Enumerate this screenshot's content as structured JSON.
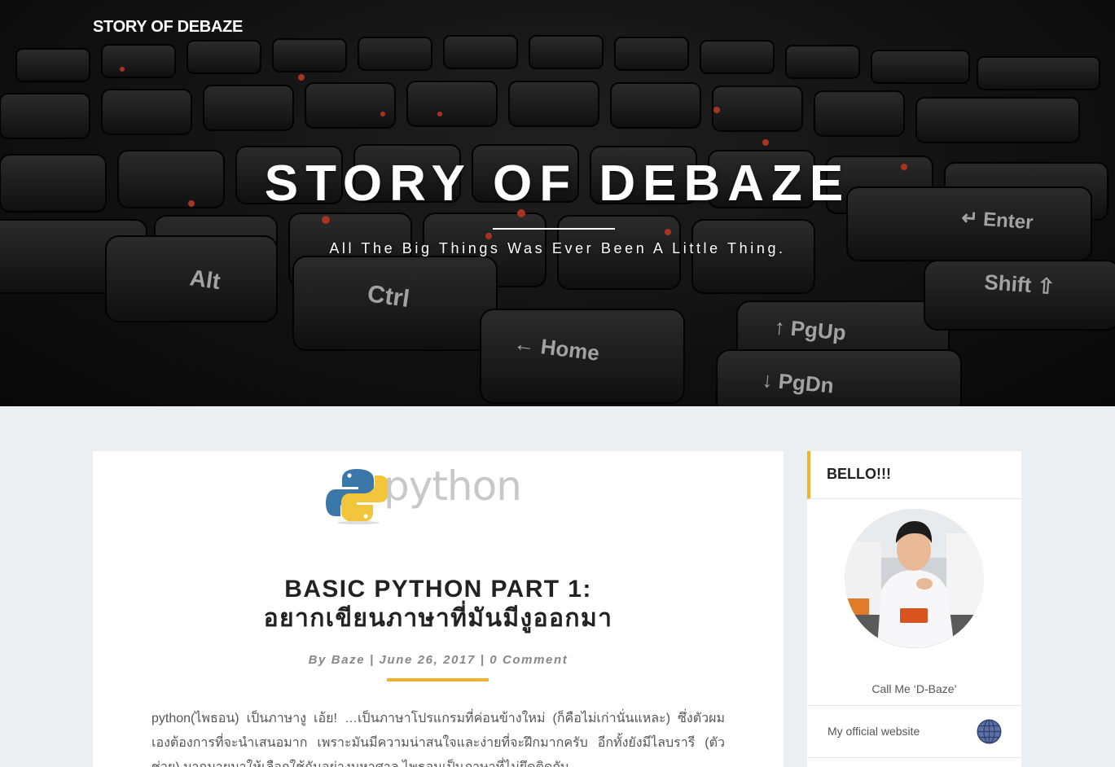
{
  "header": {
    "brand": "STORY OF DEBAZE",
    "site_title": "STORY OF DEBAZE",
    "tagline": "All The Big Things Was Ever Been A Little Thing."
  },
  "post": {
    "logo_text": "python",
    "title_line1": "BASIC PYTHON PART 1:",
    "title_line2": "อยากเขียนภาษาที่มันมีงูออกมา",
    "meta": {
      "by": "By",
      "author": "Baze",
      "sep": "|",
      "date": "June 26, 2017",
      "comments": "0 Comment"
    },
    "excerpt": "python(ไพธอน) เป็นภาษางู เอ้ย! …เป็นภาษาโปรแกรมที่ค่อนข้างใหม่ (ก็คือไม่เก่านั่นแหละ) ซึ่งตัวผมเองต้องการที่จะนำเสนอมาก เพราะมันมีความน่าสนใจและง่ายที่จะฝึกมากครับ อีกทั้งยังมีไลบรารี (ตัวช่วย) มากมายมาให้เลือกใช้กันอย่างมหาศาล ไพธอนเป็นภาษาที่ไม่ยึดติดกับ"
  },
  "sidebar": {
    "widget_title": "BELLO!!!",
    "caption": "Call Me ‘D-Baze’",
    "link_label": "My official website",
    "link_icon": "globe-icon"
  },
  "colors": {
    "accent": "#f4b12e",
    "page_bg": "#ebeff2"
  }
}
